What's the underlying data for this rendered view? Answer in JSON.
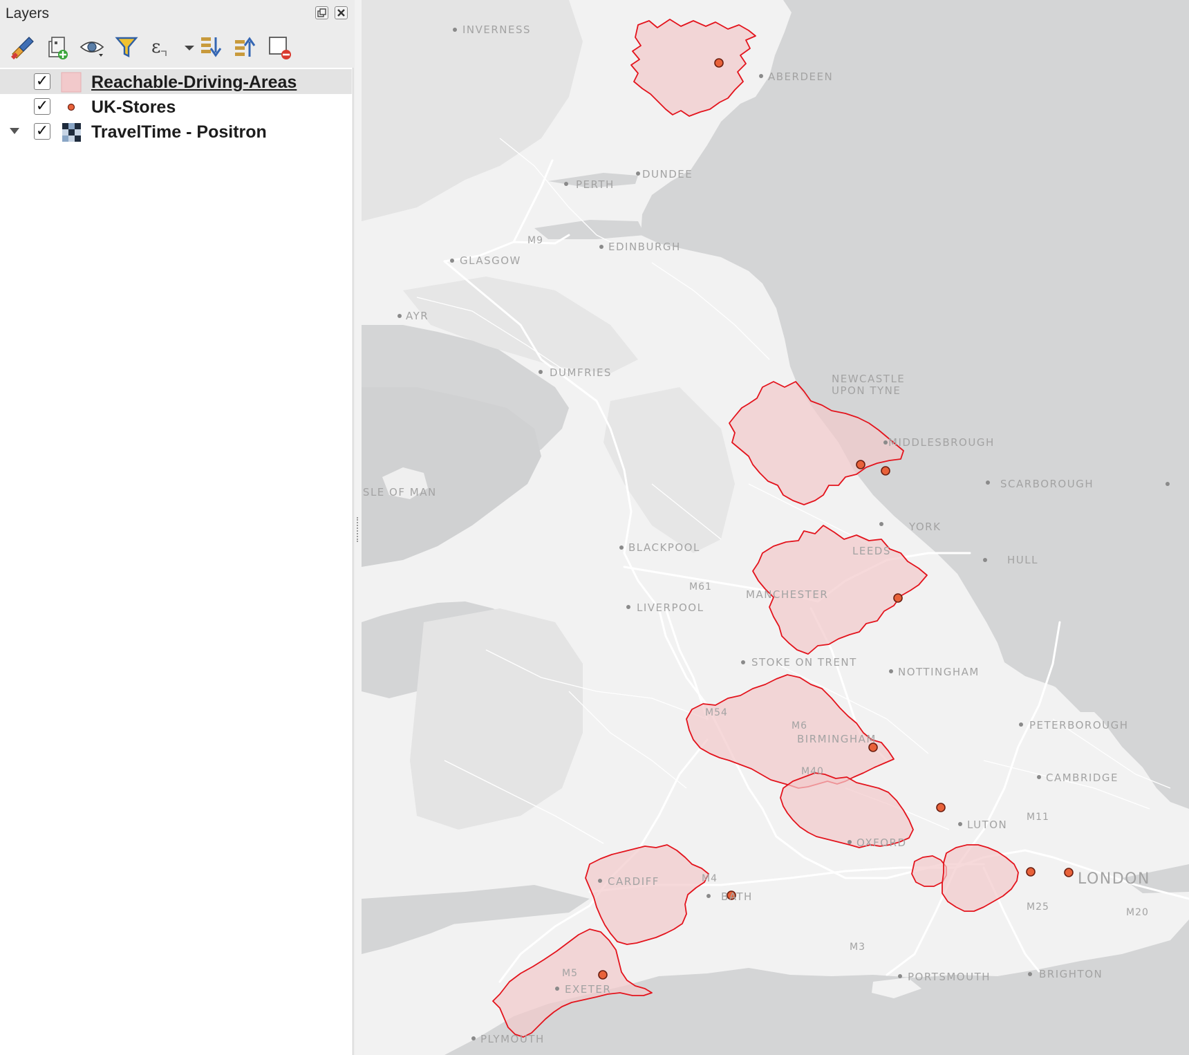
{
  "panel": {
    "title": "Layers",
    "toolbar": [
      {
        "name": "style-manager-button",
        "icon": "paintbrush-icon"
      },
      {
        "name": "add-group-button",
        "icon": "add-group-icon"
      },
      {
        "name": "visibility-button",
        "icon": "eye-icon"
      },
      {
        "name": "filter-legend-button",
        "icon": "filter-icon"
      },
      {
        "name": "filter-expression-button",
        "icon": "expression-icon"
      },
      {
        "name": "expand-all-button",
        "icon": "expand-all-icon"
      },
      {
        "name": "collapse-all-button",
        "icon": "collapse-all-icon"
      },
      {
        "name": "remove-layer-button",
        "icon": "remove-layer-icon"
      }
    ],
    "layers": [
      {
        "name": "Reachable-Driving-Areas",
        "checked": "✓",
        "symbol": "polygon-fill",
        "selected": true
      },
      {
        "name": "UK-Stores",
        "checked": "✓",
        "symbol": "point-marker",
        "selected": false
      },
      {
        "name": "TravelTime - Positron",
        "checked": "✓",
        "symbol": "raster-tiles",
        "selected": false,
        "expandable": true
      }
    ]
  },
  "map": {
    "basemap": "TravelTime - Positron",
    "colors": {
      "sea": "#d4d5d6",
      "land": "#f2f2f2",
      "highland": "#e3e3e3",
      "area_stroke": "#e3131c",
      "area_fill": "#f2c9cb",
      "store_fill": "#e8623a",
      "store_stroke": "#6a1e10"
    },
    "places": [
      "INVERNESS",
      "ABERDEEN",
      "PERTH",
      "DUNDEE",
      "EDINBURGH",
      "GLASGOW",
      "AYR",
      "DUMFRIES",
      "NEWCASTLE",
      "UPON TYNE",
      "MIDDLESBROUGH",
      "SCARBOROUGH",
      "ISLE OF MAN",
      "YORK",
      "BLACKPOOL",
      "LEEDS",
      "HULL",
      "MANCHESTER",
      "LIVERPOOL",
      "STOKE ON TRENT",
      "NOTTINGHAM",
      "PETERBOROUGH",
      "BIRMINGHAM",
      "CAMBRIDGE",
      "LUTON",
      "OXFORD",
      "CARDIFF",
      "BATH",
      "LONDON",
      "EXETER",
      "PLYMOUTH",
      "PORTSMOUTH",
      "BRIGHTON"
    ],
    "roads": [
      "M9",
      "M61",
      "M54",
      "M6",
      "M40",
      "M11",
      "M4",
      "M5",
      "M3",
      "M20",
      "M25"
    ]
  }
}
